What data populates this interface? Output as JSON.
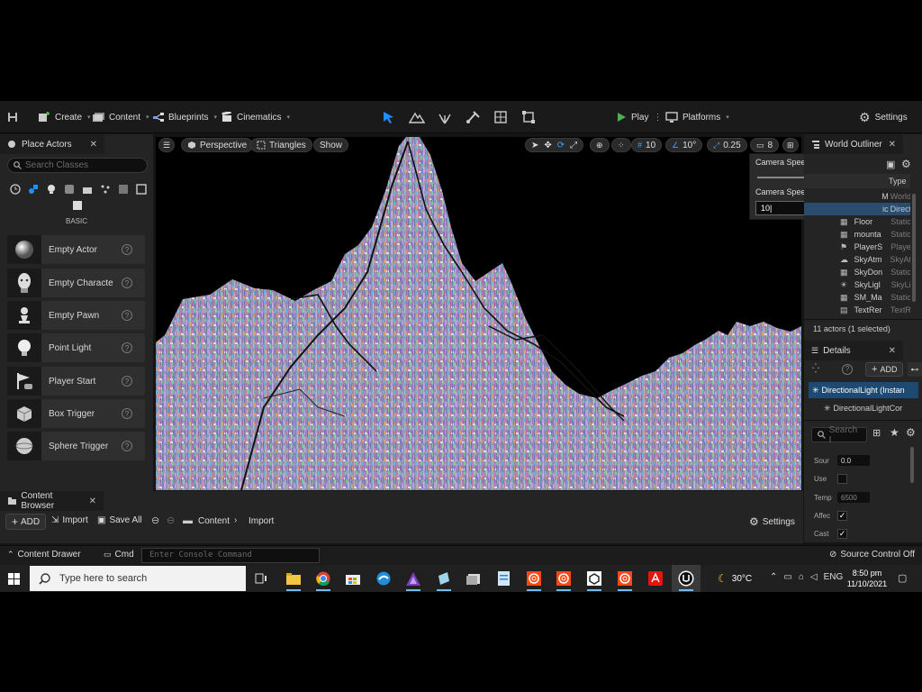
{
  "toolbar": {
    "create": "Create",
    "content": "Content",
    "blueprints": "Blueprints",
    "cinematics": "Cinematics",
    "play": "Play",
    "platforms": "Platforms",
    "settings": "Settings"
  },
  "place_actors": {
    "tab": "Place Actors",
    "search_placeholder": "Search Classes",
    "section": "BASIC",
    "items": [
      {
        "label": "Empty Actor"
      },
      {
        "label": "Empty Characte"
      },
      {
        "label": "Empty Pawn"
      },
      {
        "label": "Point Light"
      },
      {
        "label": "Player Start"
      },
      {
        "label": "Box Trigger"
      },
      {
        "label": "Sphere Trigger"
      }
    ]
  },
  "viewport": {
    "perspective": "Perspective",
    "view_mode": "Triangles",
    "show": "Show",
    "grid_snap": "10",
    "rotation_snap": "10°",
    "scale_snap": "0.25",
    "camera_speed_badge": "8"
  },
  "camera_popup": {
    "speed_label": "Camera Speed",
    "speed_value": "8",
    "speed_fraction": 0.9,
    "scalar_label": "Camera Speed Scalar",
    "scalar_value": "10"
  },
  "outliner": {
    "tab": "World Outliner",
    "type_header": "Type",
    "rows": [
      {
        "name": "M",
        "type": "World"
      },
      {
        "name": "ic",
        "type": "Direct"
      },
      {
        "name": "Floor",
        "type": "Static"
      },
      {
        "name": "mounta",
        "type": "Static"
      },
      {
        "name": "PlayerS",
        "type": "Playe"
      },
      {
        "name": "SkyAtm",
        "type": "SkyAt"
      },
      {
        "name": "SkyDon",
        "type": "Static"
      },
      {
        "name": "SkyLigl",
        "type": "SkyLi"
      },
      {
        "name": "SM_Ma",
        "type": "Static"
      },
      {
        "name": "TextRer",
        "type": "TextR"
      }
    ],
    "status": "11 actors (1 selected)"
  },
  "details": {
    "tab": "Details",
    "add_label": "ADD",
    "selected_actor": "DirectionalLight (Instan",
    "component": "DirectionalLightCor",
    "search_placeholder": "Search I",
    "props": [
      {
        "label": "Sour",
        "kind": "number",
        "value": "0.0"
      },
      {
        "label": "Use",
        "kind": "check",
        "value": ""
      },
      {
        "label": "Temp",
        "kind": "number",
        "value": "6500"
      },
      {
        "label": "Affec",
        "kind": "check",
        "value": "✓"
      },
      {
        "label": "Cast",
        "kind": "check",
        "value": "✓"
      }
    ]
  },
  "content_browser": {
    "tab": "Content Browser",
    "add": "ADD",
    "import": "Import",
    "save_all": "Save All",
    "crumb1": "Content",
    "crumb2": "Import",
    "settings": "Settings"
  },
  "status_bar": {
    "content_drawer": "Content Drawer",
    "cmd": "Cmd",
    "console_placeholder": "Enter Console Command",
    "source_control": "Source Control Off"
  },
  "taskbar": {
    "search_placeholder": "Type here to search",
    "weather": "30°C",
    "lang": "ENG",
    "time": "8:50 pm",
    "date": "11/10/2021"
  }
}
